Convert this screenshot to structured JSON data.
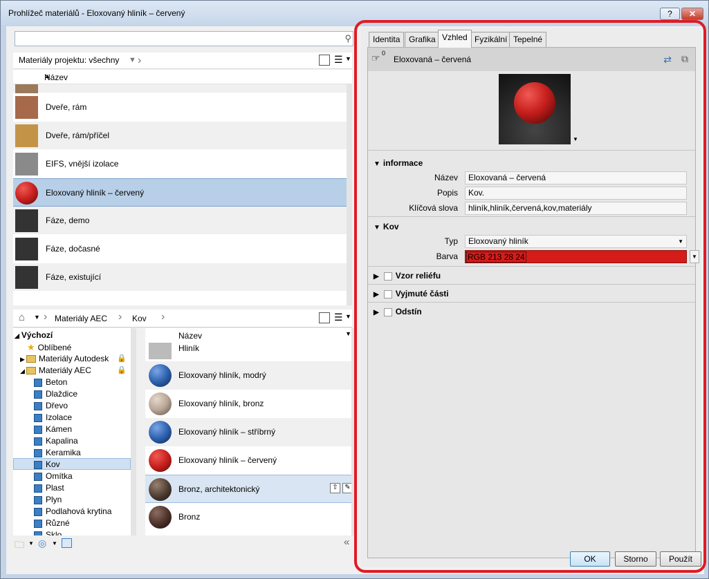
{
  "window": {
    "title": "Prohlížeč materiálů - Eloxovaný hliník – červený",
    "help_label": "?",
    "close_label": "✕"
  },
  "left": {
    "search": {
      "placeholder": ""
    },
    "project_filter": "Materiály projektu: všechny",
    "column_header": "Název",
    "project_materials": [
      {
        "label": "Dveře, rám",
        "color": "#a66a4a"
      },
      {
        "label": "Dveře, rám/příčel",
        "color": "#c39448"
      },
      {
        "label": "EIFS, vnější izolace",
        "color": "#8a8a8a"
      },
      {
        "label": "Eloxovaný hliník – červený",
        "color": "#c8201e"
      },
      {
        "label": "Fáze, demo",
        "color": "#333333"
      },
      {
        "label": "Fáze, dočasné",
        "color": "#333333"
      },
      {
        "label": "Fáze, existující",
        "color": "#333333"
      }
    ],
    "library_crumbs": [
      "Materiály AEC",
      "Kov"
    ],
    "tree": {
      "root": "Výchozí",
      "favorites": "Oblíbené",
      "autodesk": "Materiály Autodesk",
      "aec": "Materiály AEC",
      "categories": [
        "Beton",
        "Dlaždice",
        "Dřevo",
        "Izolace",
        "Kámen",
        "Kapalina",
        "Keramika",
        "Kov",
        "Omítka",
        "Plast",
        "Plyn",
        "Podlahová krytina",
        "Různé",
        "Sklo"
      ]
    },
    "library_header": "Název",
    "library_materials": [
      {
        "label": "Hliník",
        "color": "#bbbbbb"
      },
      {
        "label": "Eloxovaný hliník, modrý",
        "color": "#2e62b0"
      },
      {
        "label": "Eloxovaný hliník, bronz",
        "color": "#b8a696"
      },
      {
        "label": "Eloxovaný hliník – stříbrný",
        "color": "#2e62b0"
      },
      {
        "label": "Eloxovaný hliník – červený",
        "color": "#c8201e"
      },
      {
        "label": "Bronz, architektonický",
        "color": "#4b3b30"
      },
      {
        "label": "Bronz",
        "color": "#4a3028"
      }
    ]
  },
  "right": {
    "tabs": [
      "Identita",
      "Grafika",
      "Vzhled",
      "Fyzikální",
      "Tepelné"
    ],
    "active_tab": "Vzhled",
    "asset_count": "0",
    "asset_name": "Eloxovaná – červená",
    "info_section": "informace",
    "fields": {
      "name_label": "Název",
      "name_value": "Eloxovaná – červená",
      "desc_label": "Popis",
      "desc_value": "Kov.",
      "keywords_label": "Klíčová slova",
      "keywords_value": "hliník,hliník,červená,kov,materiály"
    },
    "metal_section": "Kov",
    "type_label": "Typ",
    "type_value": "Eloxovaný hliník",
    "color_label": "Barva",
    "color_value": "RGB 213 28 24",
    "extra_sections": [
      "Vzor reliéfu",
      "Vyjmuté části",
      "Odstín"
    ],
    "buttons": {
      "ok": "OK",
      "cancel": "Storno",
      "apply": "Použít"
    }
  },
  "colors": {
    "accent_red": "#e01b24",
    "selection_blue": "#b8cfe8",
    "material_red": "#d51c18"
  }
}
